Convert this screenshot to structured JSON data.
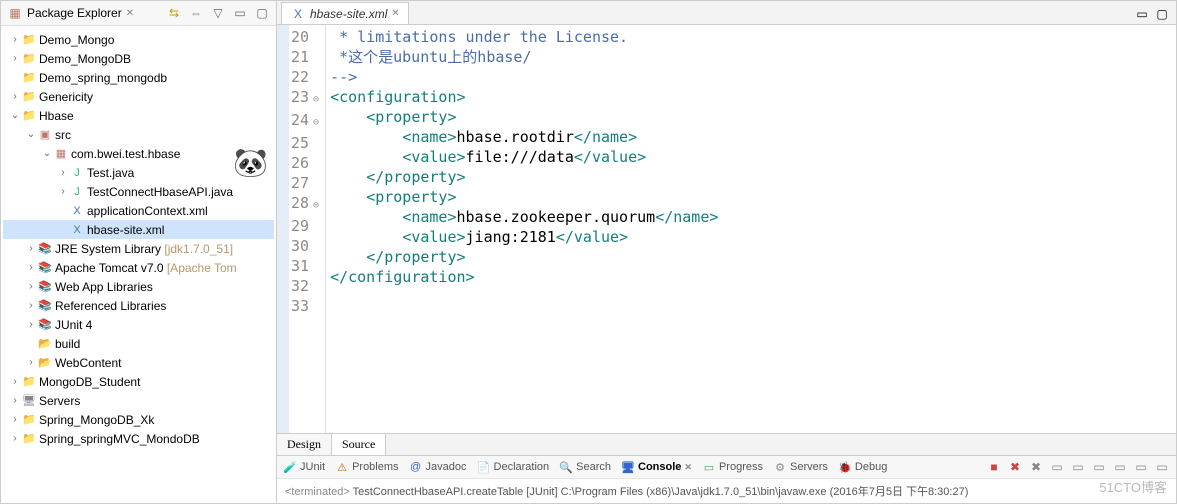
{
  "sidebar": {
    "title": "Package Explorer",
    "tree": [
      {
        "level": 0,
        "twisty": ">",
        "icon": "proj",
        "label": "Demo_Mongo"
      },
      {
        "level": 0,
        "twisty": ">",
        "icon": "proj",
        "label": "Demo_MongoDB"
      },
      {
        "level": 0,
        "twisty": "",
        "icon": "folder-blue",
        "label": "Demo_spring_mongodb"
      },
      {
        "level": 0,
        "twisty": ">",
        "icon": "proj",
        "label": "Genericity"
      },
      {
        "level": 0,
        "twisty": "v",
        "icon": "proj",
        "label": "Hbase"
      },
      {
        "level": 1,
        "twisty": "v",
        "icon": "src",
        "label": "src"
      },
      {
        "level": 2,
        "twisty": "v",
        "icon": "pkg",
        "label": "com.bwei.test.hbase"
      },
      {
        "level": 3,
        "twisty": ">",
        "icon": "java",
        "label": "Test.java"
      },
      {
        "level": 3,
        "twisty": ">",
        "icon": "java",
        "label": "TestConnectHbaseAPI.java"
      },
      {
        "level": 3,
        "twisty": "",
        "icon": "xml",
        "label": "applicationContext.xml"
      },
      {
        "level": 3,
        "twisty": "",
        "icon": "xml",
        "label": "hbase-site.xml",
        "selected": true
      },
      {
        "level": 1,
        "twisty": ">",
        "icon": "jar",
        "label": "JRE System Library",
        "detail": "[jdk1.7.0_51]"
      },
      {
        "level": 1,
        "twisty": ">",
        "icon": "jar",
        "label": "Apache Tomcat v7.0",
        "detail": "[Apache Tom"
      },
      {
        "level": 1,
        "twisty": ">",
        "icon": "jar",
        "label": "Web App Libraries"
      },
      {
        "level": 1,
        "twisty": ">",
        "icon": "jar",
        "label": "Referenced Libraries"
      },
      {
        "level": 1,
        "twisty": ">",
        "icon": "jar",
        "label": "JUnit 4"
      },
      {
        "level": 1,
        "twisty": "",
        "icon": "folder",
        "label": "build"
      },
      {
        "level": 1,
        "twisty": ">",
        "icon": "folder",
        "label": "WebContent"
      },
      {
        "level": 0,
        "twisty": ">",
        "icon": "proj",
        "label": "MongoDB_Student"
      },
      {
        "level": 0,
        "twisty": ">",
        "icon": "srv",
        "label": "Servers"
      },
      {
        "level": 0,
        "twisty": ">",
        "icon": "proj",
        "label": "Spring_MongoDB_Xk"
      },
      {
        "level": 0,
        "twisty": ">",
        "icon": "proj",
        "label": "Spring_springMVC_MondoDB"
      }
    ]
  },
  "editor": {
    "tab_label": "hbase-site.xml",
    "lines": [
      {
        "n": 20,
        "fold": "",
        "cls": "cmt",
        "text": " * limitations under the License."
      },
      {
        "n": 21,
        "fold": "",
        "cls": "cmt",
        "text": " *这个是ubuntu上的hbase/"
      },
      {
        "n": 22,
        "fold": "",
        "cls": "cmt",
        "text": "-->"
      },
      {
        "n": 23,
        "fold": "⊖",
        "parts": [
          {
            "t": "<configuration>",
            "c": "tag"
          }
        ]
      },
      {
        "n": 24,
        "fold": "⊖",
        "parts": [
          {
            "t": "    ",
            "c": "txt"
          },
          {
            "t": "<property>",
            "c": "tag"
          }
        ]
      },
      {
        "n": 25,
        "fold": "",
        "parts": [
          {
            "t": "        ",
            "c": "txt"
          },
          {
            "t": "<name>",
            "c": "tag"
          },
          {
            "t": "hbase.rootdir",
            "c": "txt"
          },
          {
            "t": "</name>",
            "c": "tag"
          }
        ]
      },
      {
        "n": 26,
        "fold": "",
        "parts": [
          {
            "t": "        ",
            "c": "txt"
          },
          {
            "t": "<value>",
            "c": "tag"
          },
          {
            "t": "file:///data",
            "c": "txt"
          },
          {
            "t": "</value>",
            "c": "tag"
          }
        ]
      },
      {
        "n": 27,
        "fold": "",
        "parts": [
          {
            "t": "    ",
            "c": "txt"
          },
          {
            "t": "</property>",
            "c": "tag"
          }
        ]
      },
      {
        "n": 28,
        "fold": "⊖",
        "parts": [
          {
            "t": "    ",
            "c": "txt"
          },
          {
            "t": "<property>",
            "c": "tag"
          }
        ]
      },
      {
        "n": 29,
        "fold": "",
        "parts": [
          {
            "t": "        ",
            "c": "txt"
          },
          {
            "t": "<name>",
            "c": "tag"
          },
          {
            "t": "hbase.zookeeper.quorum",
            "c": "txt"
          },
          {
            "t": "</name>",
            "c": "tag"
          }
        ]
      },
      {
        "n": 30,
        "fold": "",
        "parts": [
          {
            "t": "        ",
            "c": "txt"
          },
          {
            "t": "<value>",
            "c": "tag"
          },
          {
            "t": "jiang:2181",
            "c": "txt"
          },
          {
            "t": "</value>",
            "c": "tag"
          }
        ]
      },
      {
        "n": 31,
        "fold": "",
        "parts": [
          {
            "t": "    ",
            "c": "txt"
          },
          {
            "t": "</property>",
            "c": "tag"
          }
        ]
      },
      {
        "n": 32,
        "fold": "",
        "parts": [
          {
            "t": "</configuration>",
            "c": "tag"
          }
        ]
      },
      {
        "n": 33,
        "fold": "",
        "parts": [
          {
            "t": "",
            "c": "txt"
          }
        ]
      }
    ],
    "design_tab": "Design",
    "source_tab": "Source"
  },
  "bottom": {
    "tabs": [
      {
        "icon": "🧪",
        "label": "JUnit",
        "color": "#6a4"
      },
      {
        "icon": "⚠",
        "label": "Problems",
        "color": "#c60"
      },
      {
        "icon": "@",
        "label": "Javadoc",
        "color": "#36c"
      },
      {
        "icon": "📄",
        "label": "Declaration",
        "color": "#c90"
      },
      {
        "icon": "🔍",
        "label": "Search",
        "color": "#c90"
      },
      {
        "icon": "🖥",
        "label": "Console",
        "color": "#36c",
        "active": true
      },
      {
        "icon": "▭",
        "label": "Progress",
        "color": "#3a6"
      },
      {
        "icon": "⚙",
        "label": "Servers",
        "color": "#888"
      },
      {
        "icon": "🐞",
        "label": "Debug",
        "color": "#6a4"
      }
    ],
    "action_icons": [
      "■",
      "✖",
      "✖",
      "▭",
      "▭",
      "▭",
      "▭",
      "▭",
      "▭"
    ],
    "status_prefix": "<terminated>",
    "status_text": " TestConnectHbaseAPI.createTable [JUnit] C:\\Program Files (x86)\\Java\\jdk1.7.0_51\\bin\\javaw.exe (2016年7月5日 下午8:30:27)"
  },
  "watermark": "51CTO博客"
}
